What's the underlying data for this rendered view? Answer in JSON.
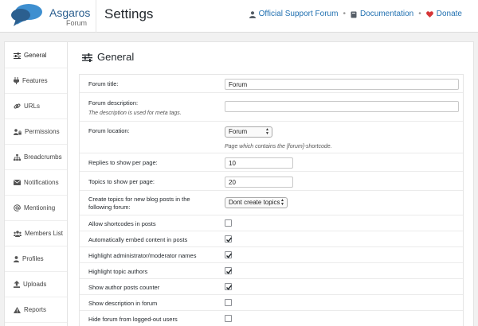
{
  "brand": {
    "name": "Asgaros",
    "sub": "Forum"
  },
  "header": {
    "title": "Settings",
    "links": [
      {
        "label": "Official Support Forum",
        "icon": "user-icon",
        "color": "#2271b1"
      },
      {
        "label": "Documentation",
        "icon": "book-icon",
        "color": "#2271b1"
      },
      {
        "label": "Donate",
        "icon": "heart-icon",
        "color": "#d63638"
      }
    ]
  },
  "sidebar": {
    "items": [
      {
        "label": "General",
        "icon": "sliders-icon"
      },
      {
        "label": "Features",
        "icon": "plug-icon"
      },
      {
        "label": "URLs",
        "icon": "link-icon"
      },
      {
        "label": "Permissions",
        "icon": "user-lock-icon"
      },
      {
        "label": "Breadcrumbs",
        "icon": "sitemap-icon"
      },
      {
        "label": "Notifications",
        "icon": "envelope-icon"
      },
      {
        "label": "Mentioning",
        "icon": "at-icon"
      },
      {
        "label": "Members List",
        "icon": "users-icon"
      },
      {
        "label": "Profiles",
        "icon": "user-icon"
      },
      {
        "label": "Uploads",
        "icon": "upload-icon"
      },
      {
        "label": "Reports",
        "icon": "warning-icon"
      }
    ]
  },
  "main": {
    "title": "General",
    "fields": {
      "forum_title": {
        "label": "Forum title:",
        "value": "Forum"
      },
      "forum_description": {
        "label": "Forum description:",
        "desc": "The description is used for meta tags.",
        "value": ""
      },
      "forum_location": {
        "label": "Forum location:",
        "value": "Forum",
        "note": "Page which contains the [forum]-shortcode."
      },
      "replies_per_page": {
        "label": "Replies to show per page:",
        "value": "10"
      },
      "topics_per_page": {
        "label": "Topics to show per page:",
        "value": "20"
      },
      "create_topics": {
        "label_line1": "Create topics for new blog posts in the",
        "label_line2": "following forum:",
        "value": "Dont create topics"
      },
      "allow_shortcodes": {
        "label": "Allow shortcodes in posts",
        "checked": false
      },
      "embed_content": {
        "label": "Automatically embed content in posts",
        "checked": true
      },
      "highlight_admin": {
        "label": "Highlight administrator/moderator names",
        "checked": true
      },
      "highlight_authors": {
        "label": "Highlight topic authors",
        "checked": true
      },
      "author_posts_counter": {
        "label": "Show author posts counter",
        "checked": true
      },
      "show_description": {
        "label": "Show description in forum",
        "checked": false
      },
      "hide_logged_out": {
        "label": "Hide forum from logged-out users",
        "checked": false
      }
    }
  }
}
